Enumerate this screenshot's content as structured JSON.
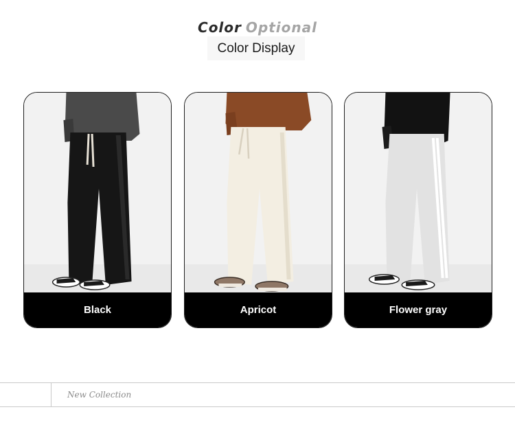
{
  "header": {
    "title_word_1": "Color",
    "title_word_2": "Optional",
    "subtitle": "Color Display"
  },
  "products": [
    {
      "label": "Black",
      "pants_color": "#161616",
      "top_color": "#4a4a4a",
      "string_color": "#e8e2d6"
    },
    {
      "label": "Apricot",
      "pants_color": "#f3eee2",
      "top_color": "#8a4a26",
      "string_color": "#ffffff"
    },
    {
      "label": "Flower gray",
      "pants_color": "#e2e2e2",
      "top_color": "#121212",
      "string_color": "#ffffff"
    }
  ],
  "footer": {
    "script_text": "New Collection"
  }
}
